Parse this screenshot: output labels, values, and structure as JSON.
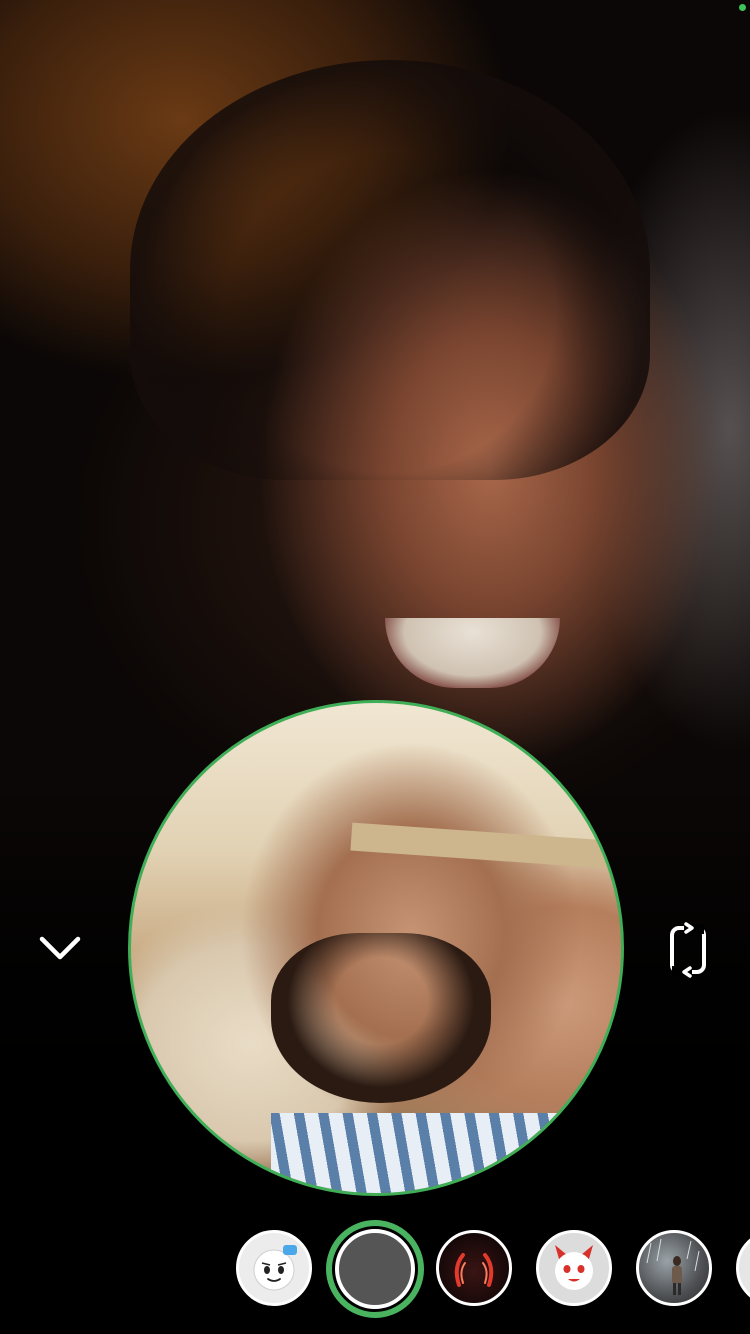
{
  "app": {
    "screen": "video-call",
    "status_indicator_color": "#3ec45a",
    "accent_color": "#4ab35f"
  },
  "remote_video": {
    "content": "remote-participant-camera-feed"
  },
  "self_view": {
    "content": "local-camera-preview",
    "border_color": "#3fae56"
  },
  "controls": {
    "collapse_icon": "chevron-down-icon",
    "flip_camera_icon": "flip-camera-icon"
  },
  "lenses": {
    "selected_index": 1,
    "items": [
      {
        "name": "lens-cartoon-face",
        "icon": "cartoon-face-icon"
      },
      {
        "name": "lens-none",
        "icon": "empty-lens-icon"
      },
      {
        "name": "lens-devil-horns",
        "icon": "devil-horns-icon"
      },
      {
        "name": "lens-devil-face",
        "icon": "devil-face-icon"
      },
      {
        "name": "lens-rain-scene",
        "icon": "rain-scene-icon"
      },
      {
        "name": "lens-partial",
        "icon": "lens-icon"
      }
    ]
  }
}
